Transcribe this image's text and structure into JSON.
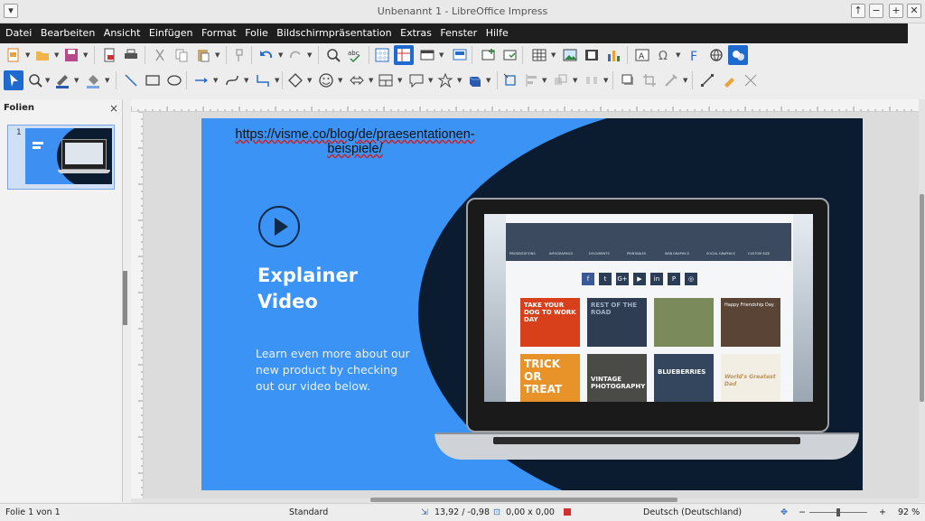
{
  "window": {
    "title": "Unbenannt 1 - LibreOffice Impress",
    "buttons": [
      "↑",
      "−",
      "+",
      "✕"
    ]
  },
  "menu": [
    "Datei",
    "Bearbeiten",
    "Ansicht",
    "Einfügen",
    "Format",
    "Folie",
    "Bildschirmpräsentation",
    "Extras",
    "Fenster",
    "Hilfe"
  ],
  "sidebar": {
    "title": "Folien",
    "close": "×",
    "slides": [
      {
        "number": "1"
      }
    ]
  },
  "slide": {
    "url_line1": "https://visme.co/blog/de/praesentationen-",
    "url_line2": "beispiele/",
    "heading_line1": "Explainer",
    "heading_line2": "Video",
    "description_line1": "Learn even more about our",
    "description_line2": "new product by checking",
    "description_line3": "out our video below.",
    "screen": {
      "nav": [
        "PRESENTATIONS",
        "INFOGRAPHICS",
        "DOCUMENTS",
        "PRINTABLES",
        "WEB GRAPHICS",
        "SOCIAL GRAPHICS",
        "CUSTOM SIZE"
      ],
      "social": [
        "f",
        "t",
        "G+",
        "▶",
        "in",
        "P",
        "◎"
      ],
      "cards": [
        "TAKE YOUR DOG TO WORK DAY",
        "REST OF THE ROAD",
        "",
        "Happy Friendship Day",
        "TRICK OR TREAT",
        "VINTAGE PHOTOGRAPHY",
        "BLUEBERRIES",
        "World's Greatest Dad"
      ]
    }
  },
  "status": {
    "slide_of": "Folie 1 von 1",
    "layout": "Standard",
    "position": "13,92 / -0,98",
    "size": "0,00 x 0,00",
    "language": "Deutsch (Deutschland)",
    "zoom": "92 %",
    "zoom_minus": "−",
    "zoom_plus": "+"
  },
  "colors": {
    "accent": "#1f6ad1",
    "slide_blue": "#3a93f5",
    "slide_dark": "#0c1c30",
    "menubar": "#1e1e1e"
  }
}
